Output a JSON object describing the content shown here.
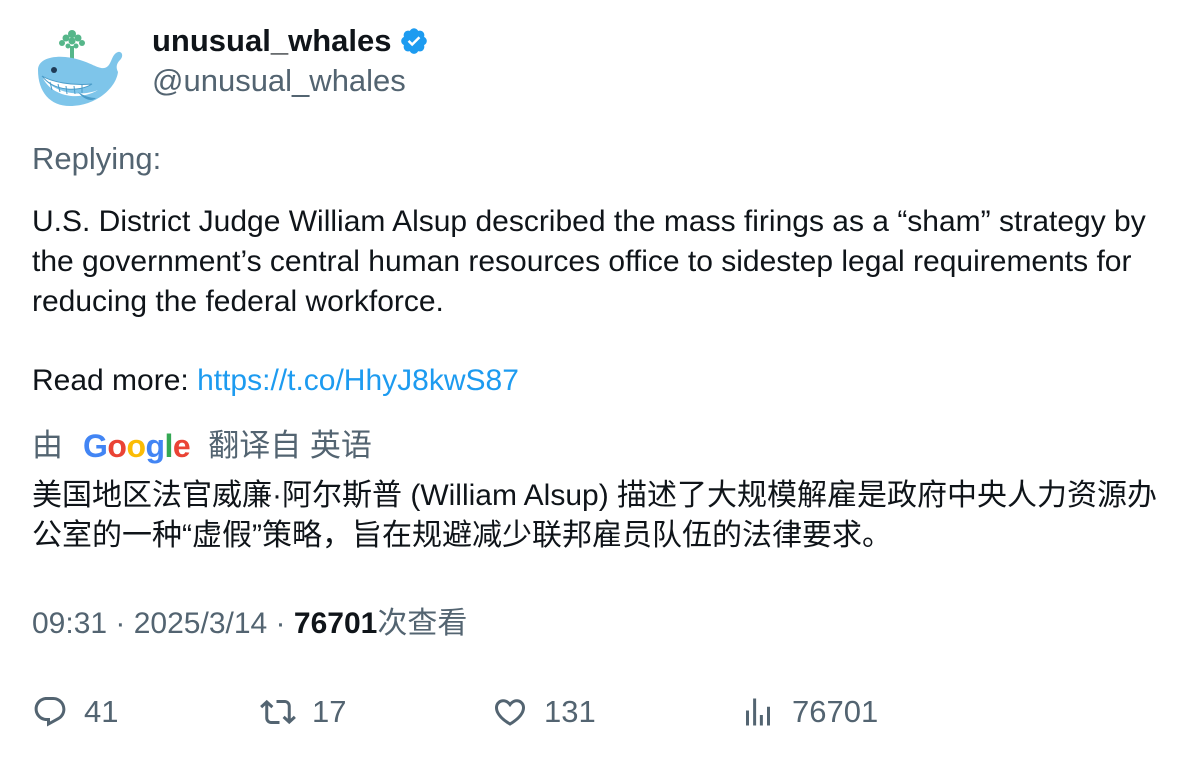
{
  "author": {
    "display_name": "unusual_whales",
    "handle": "@unusual_whales",
    "verified": true,
    "avatar_icon": "whale-avatar-icon"
  },
  "tweet": {
    "replying": "Replying:",
    "text": "U.S. District Judge William Alsup described the mass firings as a “sham” strategy by the government’s central human resources office to sidestep legal requirements for reducing the federal workforce.",
    "read_more_label": "Read more: ",
    "link": "https://t.co/HhyJ8kwS87"
  },
  "translation": {
    "prefix": "由",
    "provider": "Google",
    "suffix": "翻译自 英语",
    "text": "美国地区法官威廉·阿尔斯普 (William Alsup) 描述了大规模解雇是政府中央人力资源办公室的一种“虚假”策略，旨在规避减少联邦雇员队伍的法律要求。"
  },
  "meta": {
    "time": "09:31",
    "date": "2025/3/14",
    "separator": " · ",
    "views_count": "76701",
    "views_label": "次查看"
  },
  "actions": {
    "replies": "41",
    "retweets": "17",
    "likes": "131",
    "views": "76701"
  },
  "colors": {
    "link": "#1d9bf0",
    "muted": "#536471",
    "text": "#0f1419",
    "verified": "#1d9bf0"
  }
}
